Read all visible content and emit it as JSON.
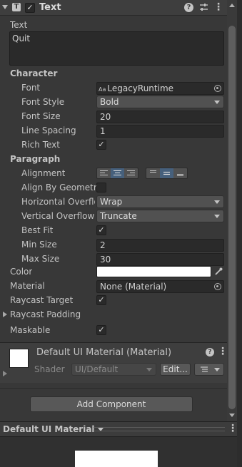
{
  "component": {
    "title": "Text",
    "enabled": true
  },
  "text_field": {
    "label": "Text",
    "value": "Quit"
  },
  "character": {
    "heading": "Character",
    "font_label": "Font",
    "font_value": "LegacyRuntime",
    "font_icon_glyph": "Aa",
    "font_style_label": "Font Style",
    "font_style_value": "Bold",
    "font_size_label": "Font Size",
    "font_size_value": "20",
    "line_spacing_label": "Line Spacing",
    "line_spacing_value": "1",
    "rich_text_label": "Rich Text",
    "rich_text_checked": true
  },
  "paragraph": {
    "heading": "Paragraph",
    "alignment_label": "Alignment",
    "align_by_geometry_label": "Align By Geometry",
    "align_by_geometry_checked": false,
    "horizontal_overflow_label": "Horizontal Overflow",
    "horizontal_overflow_value": "Wrap",
    "vertical_overflow_label": "Vertical Overflow",
    "vertical_overflow_value": "Truncate",
    "best_fit_label": "Best Fit",
    "best_fit_checked": true,
    "min_size_label": "Min Size",
    "min_size_value": "2",
    "max_size_label": "Max Size",
    "max_size_value": "30"
  },
  "color_label": "Color",
  "color_value": "#ffffff",
  "material": {
    "label": "Material",
    "value": "None (Material)"
  },
  "raycast_target": {
    "label": "Raycast Target",
    "checked": true
  },
  "raycast_padding": {
    "label": "Raycast Padding"
  },
  "maskable": {
    "label": "Maskable",
    "checked": true
  },
  "material_asset": {
    "title": "Default UI Material (Material)",
    "shader_label": "Shader",
    "shader_value": "UI/Default",
    "edit_label": "Edit..."
  },
  "add_component_label": "Add Component",
  "preview": {
    "title": "Default UI Material"
  },
  "check_glyph": "✓"
}
